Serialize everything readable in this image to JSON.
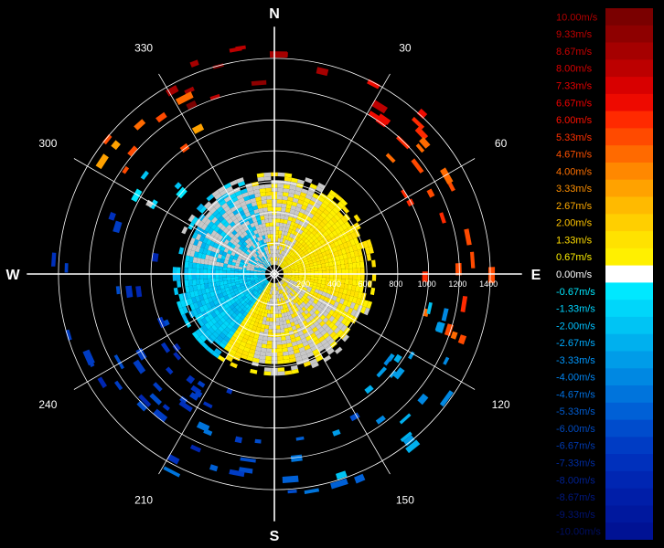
{
  "chart_data": {
    "type": "heatmap",
    "title": "",
    "subtitle": "",
    "kind": "polar radial-velocity display",
    "cardinals": [
      {
        "key": "n",
        "text": "N",
        "deg": 0
      },
      {
        "key": "e",
        "text": "E",
        "deg": 90
      },
      {
        "key": "s",
        "text": "S",
        "deg": 180
      },
      {
        "key": "w",
        "text": "W",
        "deg": 270
      }
    ],
    "bearing_labels": [
      {
        "text": "30",
        "deg": 30
      },
      {
        "text": "60",
        "deg": 60
      },
      {
        "text": "120",
        "deg": 120
      },
      {
        "text": "150",
        "deg": 150
      },
      {
        "text": "210",
        "deg": 210
      },
      {
        "text": "240",
        "deg": 240
      },
      {
        "text": "300",
        "deg": 300
      },
      {
        "text": "330",
        "deg": 330
      }
    ],
    "range_rings": [
      200,
      400,
      600,
      800,
      1000,
      1200,
      1400
    ],
    "range_max": 1500,
    "range_labels": [
      "200",
      "400",
      "600",
      "800",
      "1000",
      "1200",
      "1400"
    ],
    "colorbar": {
      "min": -10.0,
      "max": 10.0,
      "unit": "m/s",
      "labels": [
        "10.00m/s",
        "9.33m/s",
        "8.67m/s",
        "8.00m/s",
        "7.33m/s",
        "6.67m/s",
        "6.00m/s",
        "5.33m/s",
        "4.67m/s",
        "4.00m/s",
        "3.33m/s",
        "2.67m/s",
        "2.00m/s",
        "1.33m/s",
        "0.67m/s",
        "0.00m/s",
        "-0.67m/s",
        "-1.33m/s",
        "-2.00m/s",
        "-2.67m/s",
        "-3.33m/s",
        "-4.00m/s",
        "-4.67m/s",
        "-5.33m/s",
        "-6.00m/s",
        "-6.67m/s",
        "-7.33m/s",
        "-8.00m/s",
        "-8.67m/s",
        "-9.33m/s",
        "-10.00m/s"
      ],
      "colors": [
        "#7a0000",
        "#8e0000",
        "#a50000",
        "#bc0000",
        "#d80000",
        "#ee0a00",
        "#ff2a00",
        "#ff4a00",
        "#ff6a00",
        "#ff8800",
        "#ffa200",
        "#ffba00",
        "#ffcf00",
        "#ffe200",
        "#fff000",
        "#ffffff",
        "#00e8ff",
        "#00d6fa",
        "#00c4f4",
        "#00b0ee",
        "#009ce8",
        "#0088e2",
        "#0074dc",
        "#0060d6",
        "#004ccc",
        "#003cc4",
        "#0030bc",
        "#0026b2",
        "#001ea8",
        "#00189e",
        "#001294"
      ],
      "label_colors": [
        "#b40000",
        "#c00000",
        "#cc0000",
        "#d80000",
        "#e40000",
        "#f00000",
        "#ff1000",
        "#ff3000",
        "#ff5000",
        "#ff7000",
        "#ff9000",
        "#ffaa00",
        "#ffc400",
        "#ffdc00",
        "#fff000",
        "#ffffff",
        "#00e8ff",
        "#00d4ff",
        "#00c0ff",
        "#00acff",
        "#0098ff",
        "#0084f0",
        "#0070e0",
        "#005cd0",
        "#004ac0",
        "#003ab0",
        "#002ca0",
        "#002090",
        "#001880",
        "#001270",
        "#000e60"
      ]
    },
    "regions": {
      "center": {
        "range": [
          0,
          650
        ],
        "approaching_sectors": [
          [
            215,
            345
          ]
        ],
        "mostly_zero_sectors": [
          [
            280,
            35
          ],
          [
            110,
            195
          ]
        ]
      },
      "sectors": [
        {
          "from": 330,
          "to": 30,
          "range": [
            1150,
            1480
          ],
          "value": 9.0
        },
        {
          "from": 20,
          "to": 50,
          "range": [
            1050,
            1400
          ],
          "value": 7.0
        },
        {
          "from": 300,
          "to": 335,
          "range": [
            950,
            1400
          ],
          "value": 4.5
        },
        {
          "from": 295,
          "to": 315,
          "range": [
            650,
            1100
          ],
          "value": -1.0
        },
        {
          "from": 40,
          "to": 110,
          "range": [
            900,
            1400
          ],
          "value": 5.5
        },
        {
          "from": 100,
          "to": 165,
          "range": [
            900,
            1450
          ],
          "value": -3.0
        },
        {
          "from": 150,
          "to": 210,
          "range": [
            1000,
            1450
          ],
          "value": -5.5
        },
        {
          "from": 200,
          "to": 290,
          "range": [
            750,
            1450
          ],
          "value": -7.0
        }
      ]
    }
  }
}
